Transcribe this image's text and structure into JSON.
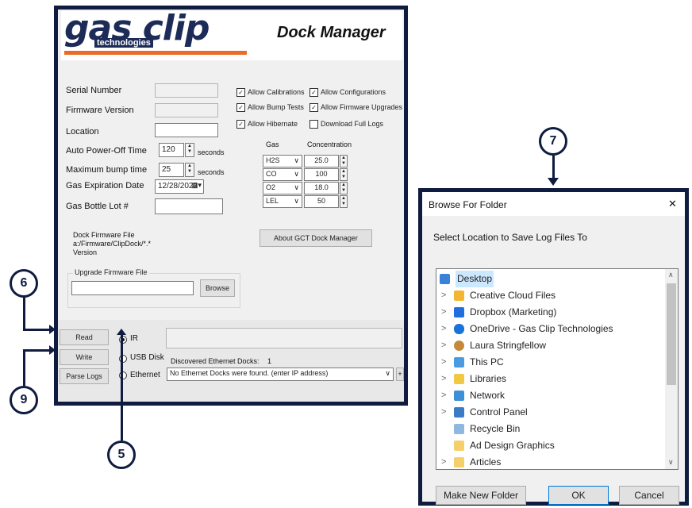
{
  "dock_manager": {
    "logo_text": "gas clip",
    "logo_sub": "technologies",
    "title": "Dock Manager",
    "fields": {
      "serial_number_label": "Serial Number",
      "firmware_version_label": "Firmware Version",
      "location_label": "Location",
      "auto_power_off_label": "Auto Power-Off Time",
      "auto_power_off_value": "120",
      "auto_power_off_unit": "seconds",
      "max_bump_label": "Maximum bump time",
      "max_bump_value": "25",
      "max_bump_unit": "seconds",
      "gas_expiration_label": "Gas Expiration Date",
      "gas_expiration_value": "12/28/2023",
      "gas_bottle_lot_label": "Gas Bottle Lot #"
    },
    "checkboxes": [
      {
        "label": "Allow Calibrations",
        "checked": true
      },
      {
        "label": "Allow Configurations",
        "checked": true
      },
      {
        "label": "Allow Bump Tests",
        "checked": true
      },
      {
        "label": "Allow Firmware Upgrades",
        "checked": true
      },
      {
        "label": "Allow Hibernate",
        "checked": true
      },
      {
        "label": "Download Full Logs",
        "checked": false
      }
    ],
    "gas_table": {
      "header_gas": "Gas",
      "header_conc": "Concentration",
      "rows": [
        {
          "gas": "H2S",
          "value": "25.0"
        },
        {
          "gas": "CO",
          "value": "100"
        },
        {
          "gas": "O2",
          "value": "18.0"
        },
        {
          "gas": "LEL",
          "value": "50"
        }
      ]
    },
    "dock_firmware": {
      "title": "Dock Firmware File",
      "path": "a:/Firmware/ClipDock/*.*",
      "version": "Version"
    },
    "upgrade_firmware": {
      "title": "Upgrade Firmware File",
      "browse": "Browse"
    },
    "about_button": "About GCT Dock Manager",
    "read_button": "Read",
    "write_button": "Write",
    "parse_logs_button": "Parse Logs",
    "radios": [
      {
        "label": "IR",
        "selected": true
      },
      {
        "label": "USB Disk",
        "selected": false
      },
      {
        "label": "Ethernet",
        "selected": false
      }
    ],
    "discovered_label": "Discovered Ethernet Docks:",
    "discovered_count": "1",
    "ethernet_value": "No Ethernet Docks were found. (enter IP address)",
    "plus": "+",
    "minus": "-"
  },
  "callouts": [
    "6",
    "9",
    "5",
    "7"
  ],
  "browse_dialog": {
    "title": "Browse For Folder",
    "close": "✕",
    "instruction": "Select Location to Save Log Files To",
    "items": [
      {
        "label": "Desktop",
        "icon": "desktop-icon",
        "color": "#3b82d6",
        "chevron": false,
        "selected": true
      },
      {
        "label": "Creative Cloud Files",
        "icon": "creative-cloud-icon",
        "color": "#f2b632",
        "chevron": true
      },
      {
        "label": "Dropbox (Marketing)",
        "icon": "dropbox-icon",
        "color": "#1f6fe0",
        "chevron": true
      },
      {
        "label": "OneDrive - Gas Clip Technologies",
        "icon": "onedrive-icon",
        "color": "#1a73d9",
        "chevron": true
      },
      {
        "label": "Laura Stringfellow",
        "icon": "user-icon",
        "color": "#c48a3a",
        "chevron": true
      },
      {
        "label": "This PC",
        "icon": "pc-icon",
        "color": "#4a9be0",
        "chevron": true
      },
      {
        "label": "Libraries",
        "icon": "libraries-icon",
        "color": "#f2c744",
        "chevron": true
      },
      {
        "label": "Network",
        "icon": "network-icon",
        "color": "#3d8fd8",
        "chevron": true
      },
      {
        "label": "Control Panel",
        "icon": "control-panel-icon",
        "color": "#3a7bc8",
        "chevron": true
      },
      {
        "label": "Recycle Bin",
        "icon": "recycle-bin-icon",
        "color": "#8fb8de",
        "chevron": false
      },
      {
        "label": "Ad Design Graphics",
        "icon": "folder-icon",
        "color": "#f5d06a",
        "chevron": false
      },
      {
        "label": "Articles",
        "icon": "folder-icon",
        "color": "#f5d06a",
        "chevron": true
      }
    ],
    "make_new_folder": "Make New Folder",
    "ok": "OK",
    "cancel": "Cancel"
  }
}
